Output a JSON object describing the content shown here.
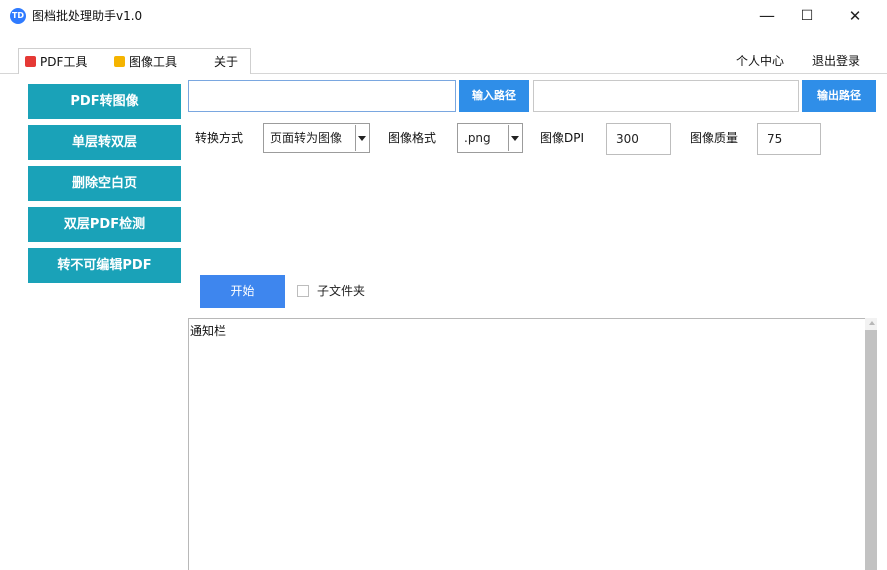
{
  "window": {
    "title": "图档批处理助手v1.0",
    "logo_text": "TD",
    "controls": [
      "minimize",
      "maximize",
      "close"
    ],
    "minimize_glyph": "—",
    "maximize_glyph": "☐",
    "close_glyph": "✕"
  },
  "tabs": [
    {
      "label": "PDF工具",
      "icon": "pdf-icon",
      "icon_color": "#e53935",
      "active": true
    },
    {
      "label": "图像工具",
      "icon": "image-icon",
      "icon_color": "#f5b400"
    },
    {
      "label": "关于"
    }
  ],
  "header_links": {
    "user_center": "个人中心",
    "logout": "退出登录"
  },
  "sidebar": {
    "color": "#1aa2b8",
    "items": [
      {
        "label": "PDF转图像"
      },
      {
        "label": "单层转双层"
      },
      {
        "label": "删除空白页"
      },
      {
        "label": "双层PDF检测"
      },
      {
        "label": "转不可编辑PDF"
      }
    ]
  },
  "paths": {
    "input_value": "",
    "input_button": "输入路径",
    "output_value": "",
    "output_button": "输出路径",
    "button_color": "#2f8ee8"
  },
  "options": {
    "mode_label": "转换方式",
    "mode_value": "页面转为图像",
    "format_label": "图像格式",
    "format_value": ".png",
    "dpi_label": "图像DPI",
    "dpi_value": "300",
    "quality_label": "图像质量",
    "quality_value": "75"
  },
  "actions": {
    "start_label": "开始",
    "start_color": "#3e86ee",
    "subfolder_label": "子文件夹",
    "subfolder_checked": false
  },
  "notification": {
    "title": "通知栏"
  }
}
